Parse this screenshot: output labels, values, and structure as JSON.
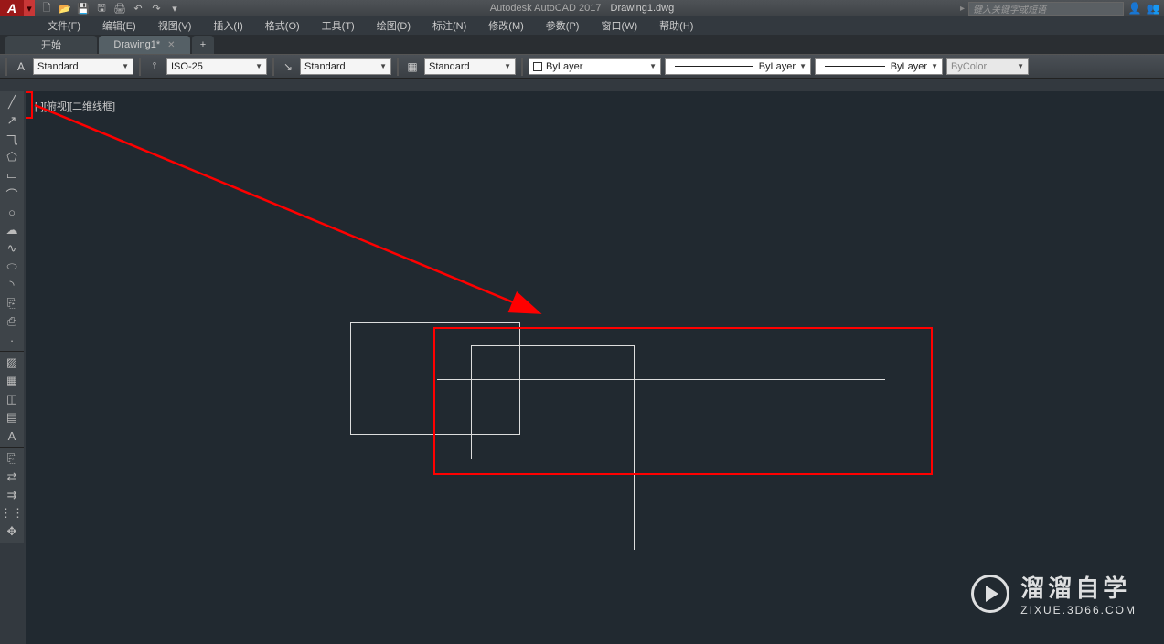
{
  "title": {
    "app": "Autodesk AutoCAD 2017",
    "doc": "Drawing1.dwg"
  },
  "search_placeholder": "键入关键字或短语",
  "menus": {
    "file": "文件(F)",
    "edit": "编辑(E)",
    "view": "视图(V)",
    "insert": "插入(I)",
    "format": "格式(O)",
    "tools": "工具(T)",
    "draw": "绘图(D)",
    "dim": "标注(N)",
    "modify": "修改(M)",
    "param": "参数(P)",
    "window": "窗口(W)",
    "help": "帮助(H)"
  },
  "tabs": {
    "start": "开始",
    "drawing": "Drawing1*",
    "plus": "+"
  },
  "styles": {
    "text": "Standard",
    "dim": "ISO-25",
    "ml": "Standard",
    "table": "Standard",
    "layer": "ByLayer",
    "linetype": "ByLayer",
    "lineweight": "ByLayer",
    "plotstyle": "ByColor"
  },
  "viewport_label": "[-][俯视][二维线框]",
  "watermark": {
    "cn": "溜溜自学",
    "en": "ZIXUE.3D66.COM"
  }
}
